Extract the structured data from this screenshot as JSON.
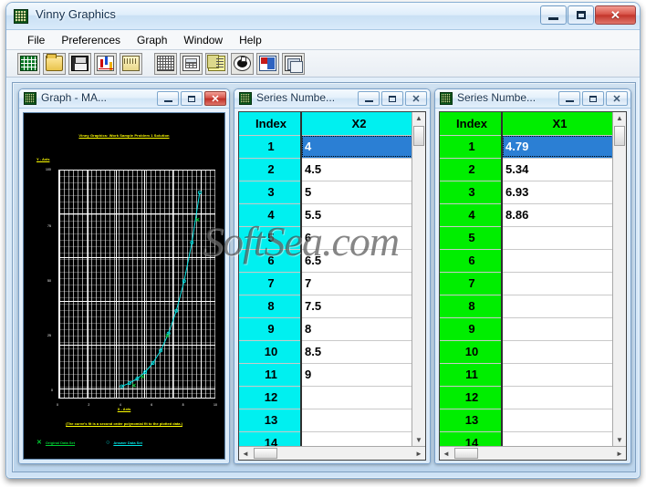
{
  "window": {
    "title": "Vinny Graphics",
    "icon": "grid-app-icon",
    "caption": {
      "minimize": "─",
      "maximize": "□",
      "close": "✕"
    }
  },
  "menubar": {
    "items": [
      {
        "label": "File"
      },
      {
        "label": "Preferences"
      },
      {
        "label": "Graph"
      },
      {
        "label": "Window"
      },
      {
        "label": "Help"
      }
    ]
  },
  "toolbar": {
    "buttons": [
      {
        "icon": "new-spreadsheet-icon",
        "name": "new-series"
      },
      {
        "icon": "open-folder-icon",
        "name": "open-file"
      },
      {
        "icon": "floppy-save-icon",
        "name": "save-file"
      },
      {
        "icon": "bar-chart-icon",
        "name": "plot-graph"
      },
      {
        "icon": "ruler-icon",
        "name": "measure"
      },
      {
        "icon": "grid-table-icon",
        "name": "data-grid"
      },
      {
        "icon": "calculator-icon",
        "name": "calculator"
      },
      {
        "icon": "copy-pages-icon",
        "name": "copy"
      },
      {
        "icon": "fan-curve-icon",
        "name": "fan-curve"
      },
      {
        "icon": "window-layout-icon",
        "name": "window-layout"
      },
      {
        "icon": "stacked-windows-icon",
        "name": "cascade-windows"
      }
    ]
  },
  "graph_window": {
    "title": "Graph  -  MA...",
    "caption": {
      "minimize": "─",
      "maximize": "□",
      "close": "✕"
    },
    "plot": {
      "title": "Vinny Graphics: Work Sample Problem 1 Solution",
      "ylabel": "Y - Axis",
      "xlabel": "X - Axis",
      "note": "(The curve's fit is a second order polynomial fit to the plotted data.)",
      "legend": [
        {
          "marker": "✕",
          "label": "Original Data Set",
          "color": "#00cc33"
        },
        {
          "marker": "○",
          "label": "Answer Data Set",
          "color": "#00e5e5"
        }
      ]
    }
  },
  "series2_window": {
    "title": "Series Numbe...",
    "caption": {
      "minimize": "─",
      "maximize": "□",
      "close": "✕"
    },
    "header_color": "#00f0f0",
    "columns": [
      "Index",
      "X2"
    ],
    "selected_row": 1,
    "rows": [
      {
        "index": "1",
        "value": "4"
      },
      {
        "index": "2",
        "value": "4.5"
      },
      {
        "index": "3",
        "value": "5"
      },
      {
        "index": "4",
        "value": "5.5"
      },
      {
        "index": "5",
        "value": "6"
      },
      {
        "index": "6",
        "value": "6.5"
      },
      {
        "index": "7",
        "value": "7"
      },
      {
        "index": "8",
        "value": "7.5"
      },
      {
        "index": "9",
        "value": "8"
      },
      {
        "index": "10",
        "value": "8.5"
      },
      {
        "index": "11",
        "value": "9"
      },
      {
        "index": "12",
        "value": ""
      },
      {
        "index": "13",
        "value": ""
      },
      {
        "index": "14",
        "value": ""
      }
    ]
  },
  "series1_window": {
    "title": "Series Numbe...",
    "caption": {
      "minimize": "─",
      "maximize": "□",
      "close": "✕"
    },
    "header_color": "#00ee00",
    "columns": [
      "Index",
      "X1"
    ],
    "selected_row": 1,
    "rows": [
      {
        "index": "1",
        "value": "4.79"
      },
      {
        "index": "2",
        "value": "5.34"
      },
      {
        "index": "3",
        "value": "6.93"
      },
      {
        "index": "4",
        "value": "8.86"
      },
      {
        "index": "5",
        "value": ""
      },
      {
        "index": "6",
        "value": ""
      },
      {
        "index": "7",
        "value": ""
      },
      {
        "index": "8",
        "value": ""
      },
      {
        "index": "9",
        "value": ""
      },
      {
        "index": "10",
        "value": ""
      },
      {
        "index": "11",
        "value": ""
      },
      {
        "index": "12",
        "value": ""
      },
      {
        "index": "13",
        "value": ""
      },
      {
        "index": "14",
        "value": ""
      }
    ]
  },
  "scrollbars": {
    "up_arrow": "▲",
    "down_arrow": "▼",
    "left_arrow": "◄",
    "right_arrow": "►"
  },
  "watermark": {
    "text": "SoftSea.com"
  },
  "chart_data": {
    "type": "line",
    "title": "Vinny Graphics: Work Sample Problem 1 Solution",
    "xlabel": "X - Axis",
    "ylabel": "Y - Axis",
    "grid": true,
    "legend_position": "bottom",
    "xlim": [
      0,
      10
    ],
    "ylim": [
      0,
      100
    ],
    "series": [
      {
        "name": "Answer Data Set",
        "color": "#00e5e5",
        "marker": "circle",
        "x": [
          4,
          4.5,
          5,
          5.5,
          6,
          6.5,
          7,
          7.5,
          8,
          8.5,
          9
        ],
        "y": [
          4.79,
          6.2,
          8.2,
          11.0,
          15.0,
          20.5,
          28.0,
          38.0,
          51.0,
          68.0,
          90.0
        ]
      },
      {
        "name": "Original Data Set",
        "color": "#00cc33",
        "marker": "cross",
        "x": [
          4.79,
          5.34,
          6.93,
          8.86
        ],
        "y": [
          5.2,
          9.0,
          27.0,
          78.0
        ]
      }
    ]
  }
}
